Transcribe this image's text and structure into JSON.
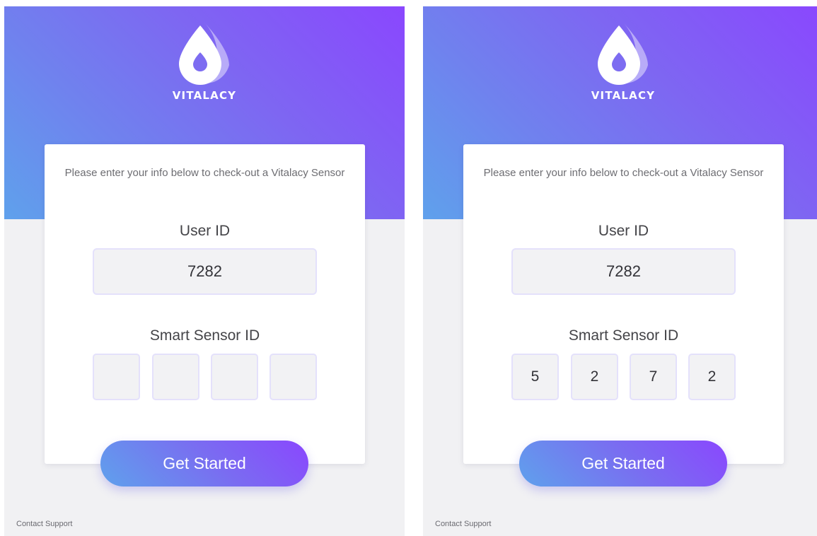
{
  "colors": {
    "gradient_start": "#5fa1ec",
    "gradient_end": "#8a47fe",
    "background": "#f1f1f3",
    "card": "#ffffff",
    "field_fill": "#f2f2f4",
    "field_border": "#e4e1fb"
  },
  "icons": {
    "logo": "water-drop-icon"
  },
  "screens": [
    {
      "brand": "VITALACY",
      "intro_text": "Please enter your info below to check-out a Vitalacy Sensor",
      "user_id_label": "User ID",
      "user_id_value": "7282",
      "sensor_id_label": "Smart Sensor ID",
      "sensor_digits": [
        "",
        "",
        "",
        ""
      ],
      "button_label": "Get Started",
      "support_link": "Contact Support"
    },
    {
      "brand": "VITALACY",
      "intro_text": "Please enter your info below to check-out a Vitalacy Sensor",
      "user_id_label": "User ID",
      "user_id_value": "7282",
      "sensor_id_label": "Smart Sensor ID",
      "sensor_digits": [
        "5",
        "2",
        "7",
        "2"
      ],
      "button_label": "Get Started",
      "support_link": "Contact Support"
    }
  ]
}
